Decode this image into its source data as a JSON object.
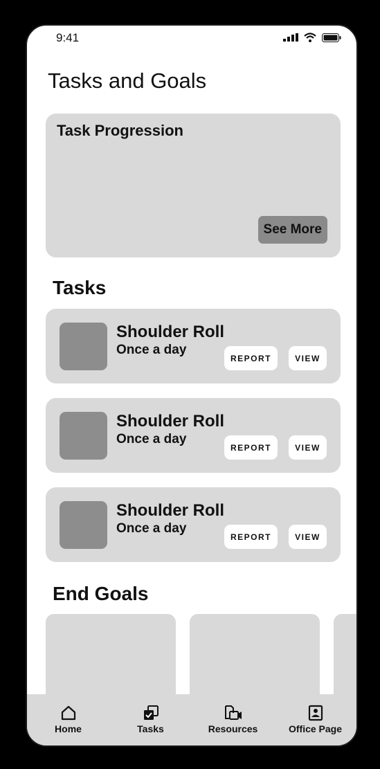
{
  "status_bar": {
    "time": "9:41"
  },
  "page": {
    "title": "Tasks and Goals"
  },
  "progress": {
    "title": "Task Progression",
    "see_more_label": "See More"
  },
  "tasks_section": {
    "title": "Tasks"
  },
  "tasks": [
    {
      "name": "Shoulder Roll",
      "frequency": "Once a day",
      "report_label": "REPORT",
      "view_label": "VIEW"
    },
    {
      "name": "Shoulder Roll",
      "frequency": "Once a day",
      "report_label": "REPORT",
      "view_label": "VIEW"
    },
    {
      "name": "Shoulder Roll",
      "frequency": "Once a day",
      "report_label": "REPORT",
      "view_label": "VIEW"
    }
  ],
  "goals_section": {
    "title": "End Goals"
  },
  "nav": {
    "items": [
      {
        "label": "Home",
        "icon": "home-icon"
      },
      {
        "label": "Tasks",
        "icon": "tasks-icon"
      },
      {
        "label": "Resources",
        "icon": "resources-icon"
      },
      {
        "label": "Office Page",
        "icon": "office-page-icon"
      }
    ]
  },
  "colors": {
    "card": "#d9d9d9",
    "thumb": "#8d8d8d",
    "button_dark": "#8a8a8a"
  }
}
